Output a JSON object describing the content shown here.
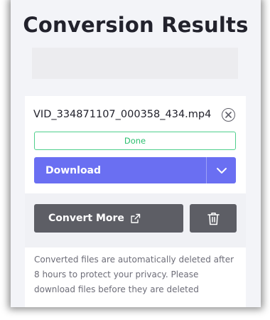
{
  "page": {
    "title": "Conversion Results"
  },
  "file": {
    "name": "VID_334871107_000358_434.mp4",
    "status": "Done",
    "remove_icon": "close-circle-icon"
  },
  "actions": {
    "download_label": "Download",
    "download_toggle_icon": "chevron-down-icon",
    "convert_more_label": "Convert More",
    "convert_more_icon": "external-link-icon",
    "delete_icon": "trash-icon"
  },
  "notice": {
    "text": "Converted files are automatically deleted after 8 hours to protect your privacy. Please download files before they are deleted"
  },
  "colors": {
    "primary": "#6a6ff2",
    "success": "#2bbf6f",
    "dark_button": "#5d5e65",
    "background": "#f3f4f8"
  }
}
